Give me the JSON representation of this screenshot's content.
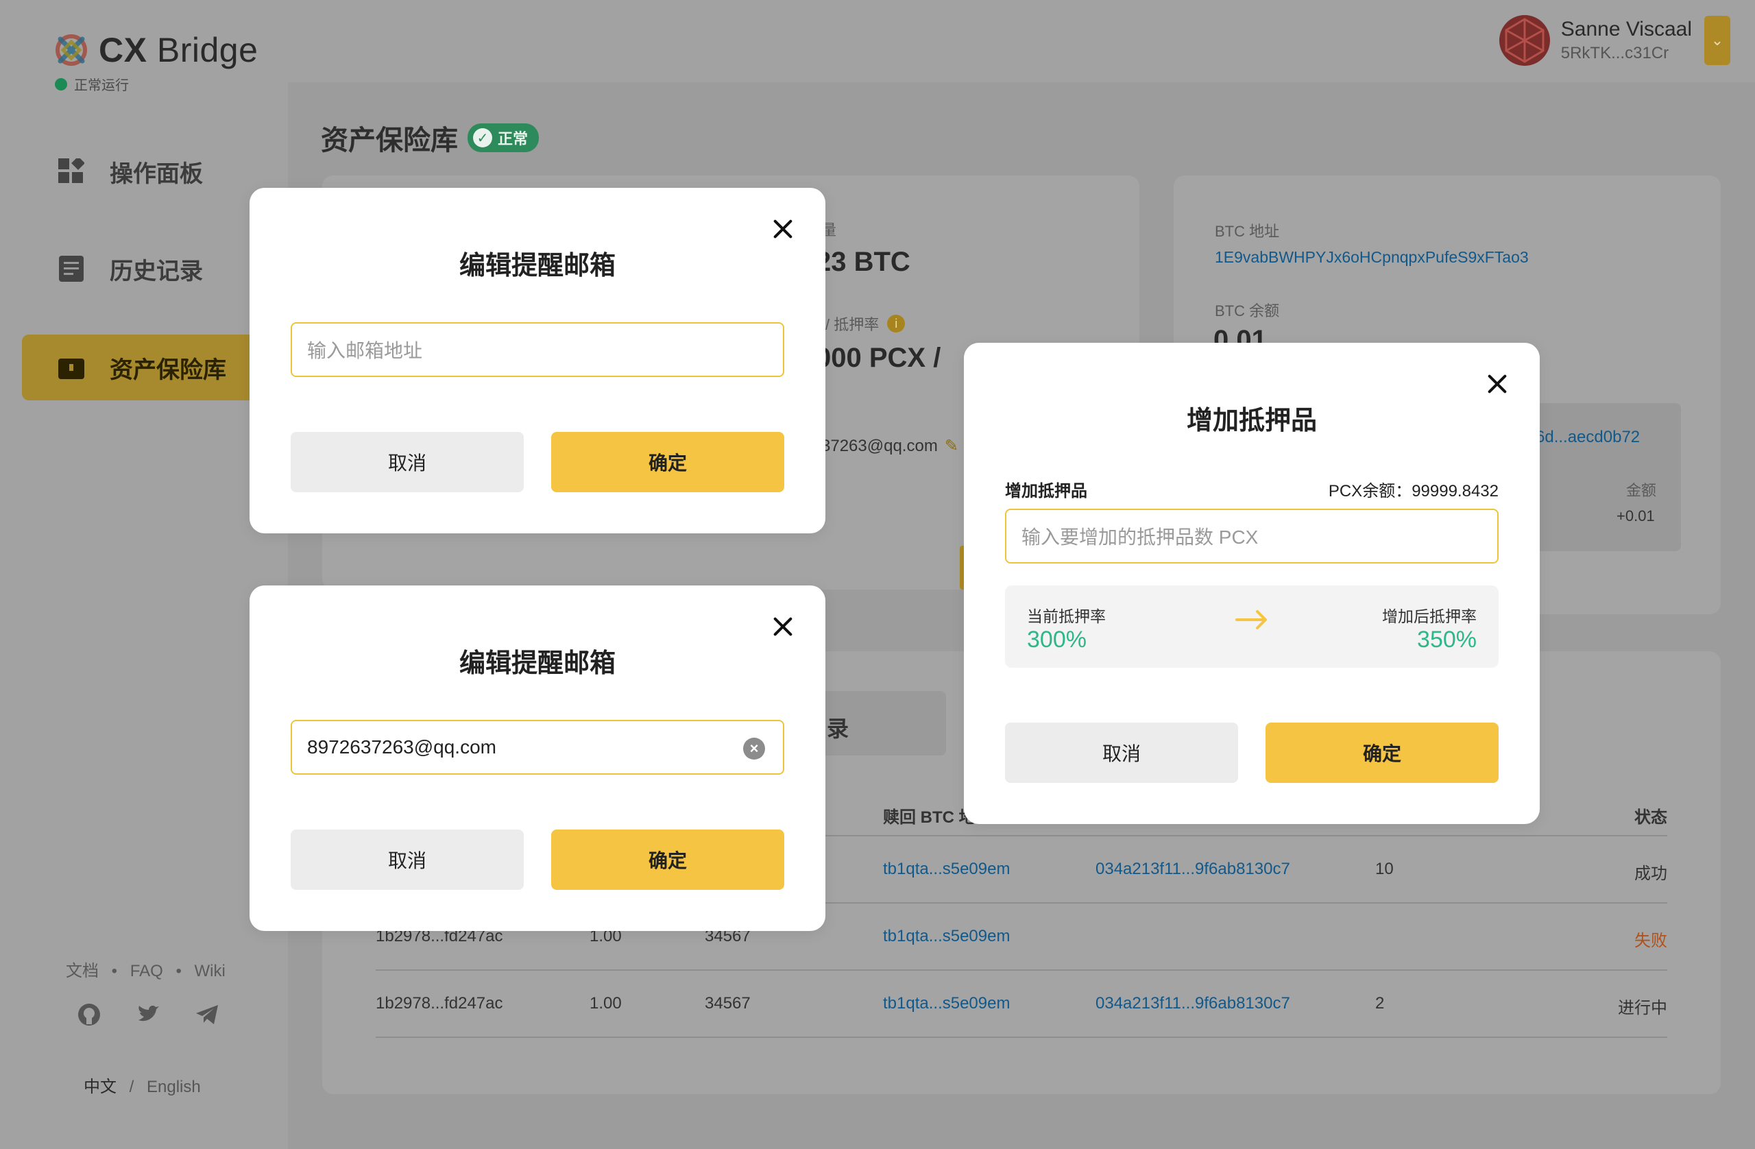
{
  "app": {
    "logo_bold": "CX",
    "logo_rest": " Bridge",
    "status": "正常运行"
  },
  "sidebar": {
    "items": [
      {
        "label": "操作面板",
        "icon": "dashboard-icon"
      },
      {
        "label": "历史记录",
        "icon": "document-icon"
      },
      {
        "label": "资产保险库",
        "icon": "vault-icon"
      }
    ],
    "footer_links": [
      "文档",
      "FAQ",
      "Wiki"
    ],
    "social": [
      "github-icon",
      "twitter-icon",
      "telegram-icon"
    ],
    "lang_cn": "中文",
    "lang_sep": "/",
    "lang_en": "English"
  },
  "user": {
    "name": "Sanne Viscaal",
    "address": "5RkTK...c31Cr"
  },
  "page": {
    "title": "资产保险库",
    "status_badge": "正常"
  },
  "vault": {
    "partial_amount_label": "量",
    "partial_amount": "23 BTC",
    "partial_collateral_label": "/ 抵押率",
    "partial_collateral": "000 PCX /",
    "partial_email": "37263@qq.com",
    "btc_address_label": "BTC 地址",
    "btc_address": "1E9vabBWHPYJx6oHCpnqpxPufeS9xFTao3",
    "btc_balance_label": "BTC 余额",
    "btc_balance": "0.01",
    "tx_hash_partial": "6d...aecd0b72",
    "amount_label": "金额",
    "amount": "+0.01"
  },
  "history": {
    "tab_partial": "录",
    "headers": {
      "redeem_btc": "赎回 BTC 地",
      "status": "状态"
    },
    "rows": [
      {
        "id": "",
        "amount": "",
        "block": "",
        "addr": "tb1qta...s5e09em",
        "tx": "034a213f11...9f6ab8130c7",
        "conf": "10",
        "status": "成功"
      },
      {
        "id": "1b2978...fd247ac",
        "amount": "1.00",
        "block": "34567",
        "addr": "tb1qta...s5e09em",
        "tx": "",
        "conf": "",
        "status": "失败"
      },
      {
        "id": "1b2978...fd247ac",
        "amount": "1.00",
        "block": "34567",
        "addr": "tb1qta...s5e09em",
        "tx": "034a213f11...9f6ab8130c7",
        "conf": "2",
        "status": "进行中"
      }
    ]
  },
  "email_modal_empty": {
    "title": "编辑提醒邮箱",
    "placeholder": "输入邮箱地址",
    "cancel": "取消",
    "confirm": "确定"
  },
  "email_modal_filled": {
    "title": "编辑提醒邮箱",
    "value": "8972637263@qq.com",
    "cancel": "取消",
    "confirm": "确定"
  },
  "collateral_modal": {
    "title": "增加抵押品",
    "field_label": "增加抵押品",
    "balance_text": "PCX余额：99999.8432",
    "placeholder": "输入要增加的抵押品数 PCX",
    "current_label": "当前抵押率",
    "current_value": "300%",
    "after_label": "增加后抵押率",
    "after_value": "350%",
    "cancel": "取消",
    "confirm": "确定"
  },
  "colors": {
    "accent": "#f5c443",
    "positive": "#2fb68a",
    "fail": "#c0531c",
    "link": "#1a7ac8"
  }
}
